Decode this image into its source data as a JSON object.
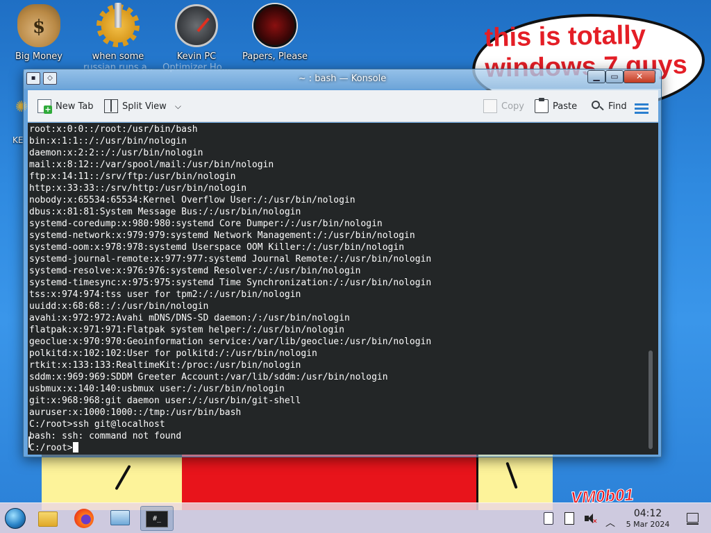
{
  "desktop": {
    "icons": [
      {
        "label": "Big Money",
        "label2": ""
      },
      {
        "label": "when some",
        "label2": "russian runs a..."
      },
      {
        "label": "Kevin PC",
        "label2": "Optimizer Ho..."
      },
      {
        "label": "Papers, Please",
        "label2": ""
      }
    ],
    "side_label": "KE",
    "bubble_text": "this is totally windows 7 guys",
    "watermark": "VM0b01"
  },
  "window": {
    "title": "~ : bash — Konsole",
    "toolbar": {
      "new_tab": "New Tab",
      "split_view": "Split View",
      "copy": "Copy",
      "paste": "Paste",
      "find": "Find"
    },
    "terminal_lines": [
      "root:x:0:0::/root:/usr/bin/bash",
      "bin:x:1:1::/:/usr/bin/nologin",
      "daemon:x:2:2::/:/usr/bin/nologin",
      "mail:x:8:12::/var/spool/mail:/usr/bin/nologin",
      "ftp:x:14:11::/srv/ftp:/usr/bin/nologin",
      "http:x:33:33::/srv/http:/usr/bin/nologin",
      "nobody:x:65534:65534:Kernel Overflow User:/:/usr/bin/nologin",
      "dbus:x:81:81:System Message Bus:/:/usr/bin/nologin",
      "systemd-coredump:x:980:980:systemd Core Dumper:/:/usr/bin/nologin",
      "systemd-network:x:979:979:systemd Network Management:/:/usr/bin/nologin",
      "systemd-oom:x:978:978:systemd Userspace OOM Killer:/:/usr/bin/nologin",
      "systemd-journal-remote:x:977:977:systemd Journal Remote:/:/usr/bin/nologin",
      "systemd-resolve:x:976:976:systemd Resolver:/:/usr/bin/nologin",
      "systemd-timesync:x:975:975:systemd Time Synchronization:/:/usr/bin/nologin",
      "tss:x:974:974:tss user for tpm2:/:/usr/bin/nologin",
      "uuidd:x:68:68::/:/usr/bin/nologin",
      "avahi:x:972:972:Avahi mDNS/DNS-SD daemon:/:/usr/bin/nologin",
      "flatpak:x:971:971:Flatpak system helper:/:/usr/bin/nologin",
      "geoclue:x:970:970:Geoinformation service:/var/lib/geoclue:/usr/bin/nologin",
      "polkitd:x:102:102:User for polkitd:/:/usr/bin/nologin",
      "rtkit:x:133:133:RealtimeKit:/proc:/usr/bin/nologin",
      "sddm:x:969:969:SDDM Greeter Account:/var/lib/sddm:/usr/bin/nologin",
      "usbmux:x:140:140:usbmux user:/:/usr/bin/nologin",
      "git:x:968:968:git daemon user:/:/usr/bin/git-shell",
      "auruser:x:1000:1000::/tmp:/usr/bin/bash",
      "C:/root>ssh git@localhost",
      "bash: ssh: command not found"
    ],
    "prompt": "C:/root>"
  },
  "taskbar": {
    "time": "04:12",
    "date": "5 Mar 2024",
    "terminal_task_label": "#_"
  },
  "colors": {
    "terminal_bg": "#232627",
    "terminal_fg": "#fcfcfc",
    "bubble_text": "#e41e26",
    "accent": "#3daee9"
  }
}
